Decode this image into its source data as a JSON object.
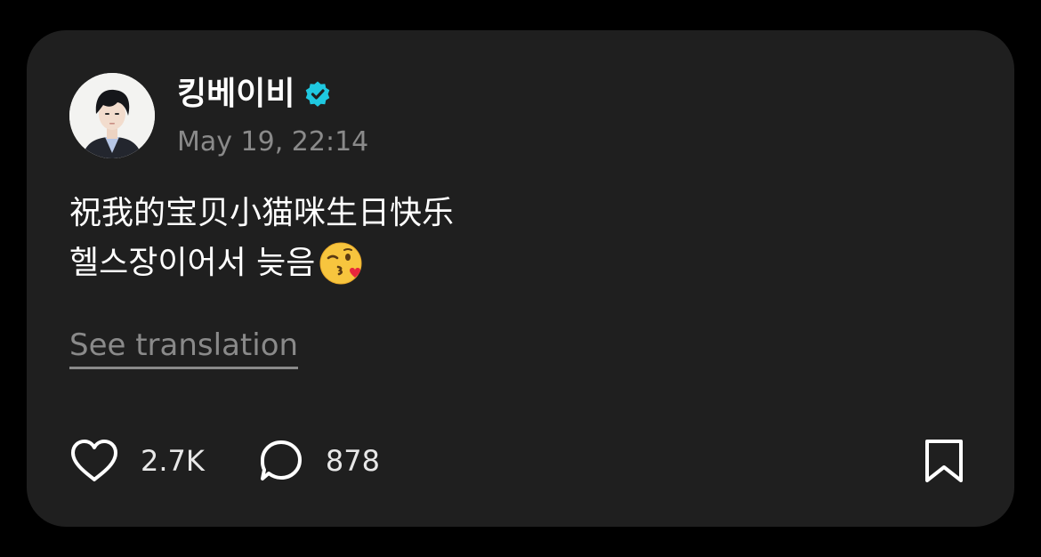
{
  "post": {
    "username": "킹베이비",
    "verified_icon": "verified-badge-icon",
    "timestamp": "May 19, 22:14",
    "body_line1": "祝我的宝贝小猫咪生日快乐",
    "body_line2": "헬스장이어서 늦음",
    "emoji": "kissing-face-with-heart-emoji",
    "see_translation": "See translation"
  },
  "actions": {
    "like_icon": "heart-icon",
    "likes": "2.7K",
    "comment_icon": "comment-bubble-icon",
    "comments": "878",
    "bookmark_icon": "bookmark-icon"
  },
  "colors": {
    "background": "#000000",
    "card": "#1f1f1f",
    "text_primary": "#ffffff",
    "text_secondary": "#8a8a8a",
    "verified": "#1fc8e0"
  }
}
